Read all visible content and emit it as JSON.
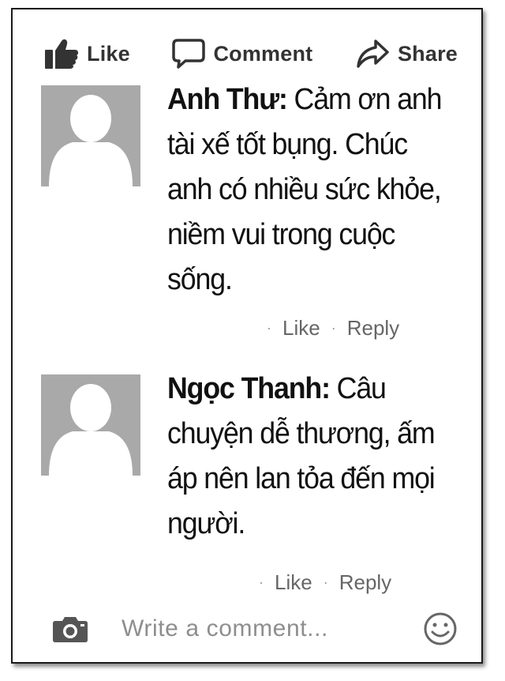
{
  "actions": {
    "like_label": "Like",
    "comment_label": "Comment",
    "share_label": "Share"
  },
  "comments": [
    {
      "author": "Anh Thư:",
      "text": " Cảm ơn anh tài xế tốt bụng. Chúc anh có nhiều sức khỏe, niềm vui trong cuộc sống.",
      "like_label": "Like",
      "reply_label": "Reply"
    },
    {
      "author": "Ngọc Thanh:",
      "text": " Câu chuyện dễ thương, ấm áp nên lan tỏa đến mọi người.",
      "like_label": "Like",
      "reply_label": "Reply"
    }
  ],
  "composer": {
    "placeholder": "Write a comment..."
  },
  "icons": {
    "like": "thumbs-up-icon",
    "comment": "speech-bubble-icon",
    "share": "share-arrow-icon",
    "camera": "camera-icon",
    "emoji": "smiley-icon"
  },
  "colors": {
    "text": "#111111",
    "meta": "#666666",
    "avatar_bg": "#a9a9a9",
    "placeholder": "#8e8e8e"
  }
}
